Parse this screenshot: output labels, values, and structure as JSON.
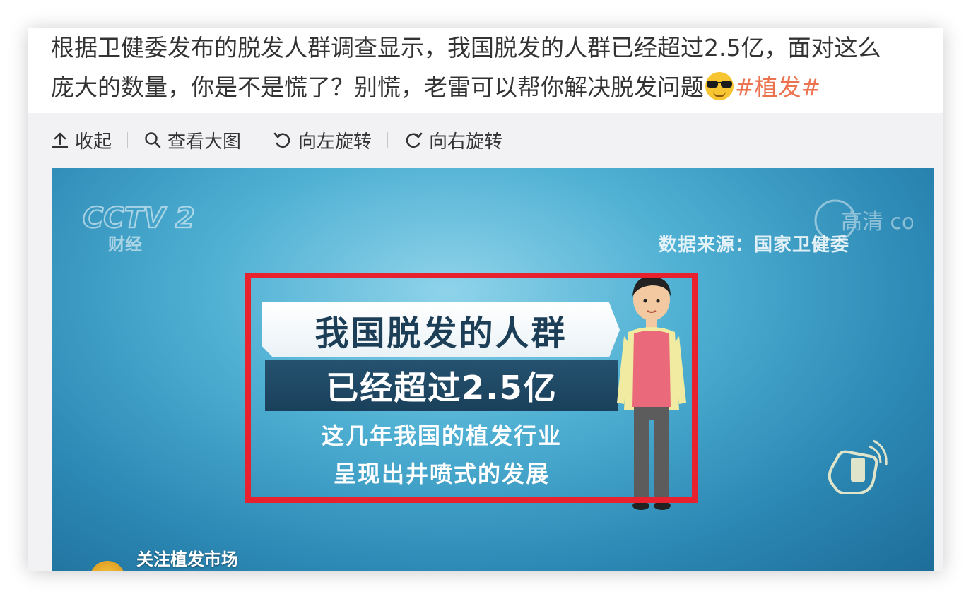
{
  "post": {
    "line1": "根据卫健委发布的脱发人群调查显示，我国脱发的人群已经超过2.5亿，面对这么",
    "line2": "庞大的数量，你是不是慌了？别慌，老雷可以帮你解决脱发问题",
    "emoji": "cool-face-sunglasses-icon",
    "hashtag": "#植发#",
    "hashtag_color": "#eb7350"
  },
  "toolbar": {
    "collapse_label": "收起",
    "view_large_label": "查看大图",
    "rotate_left_label": "向左旋转",
    "rotate_right_label": "向右旋转"
  },
  "image": {
    "channel_logo": "CCTV 2",
    "channel_sub": "财经",
    "watermark": "高清 com",
    "data_source": "数据来源：国家卫健委",
    "headline_1": "我国脱发的人群",
    "headline_2": "已经超过2.5亿",
    "subtitle_1": "这几年我国的植发行业",
    "subtitle_2": "呈现出井喷式的发展",
    "lower_third": "关注植发市场",
    "highlight_color": "#e8212e"
  }
}
